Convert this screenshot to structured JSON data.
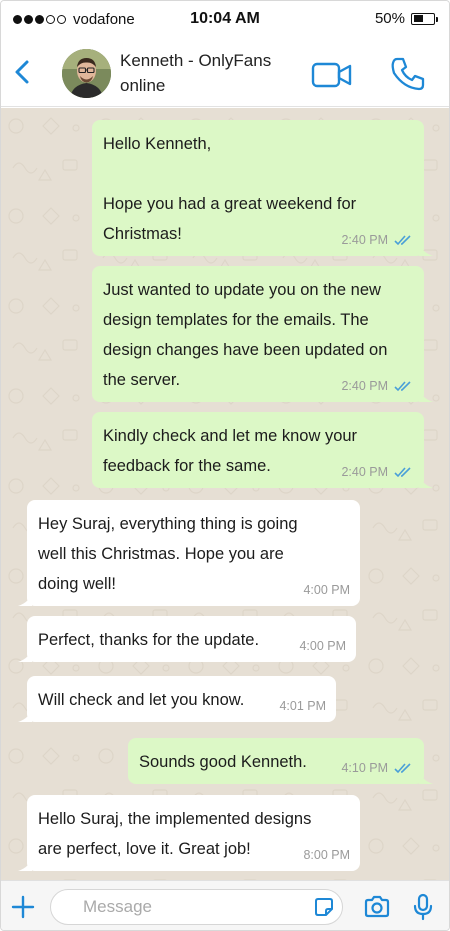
{
  "status_bar": {
    "carrier": "vodafone",
    "signal_bars_filled": 3,
    "signal_bars_total": 5,
    "time": "10:04 AM",
    "battery_text": "50%",
    "battery_level": 0.5
  },
  "header": {
    "contact_name": "Kenneth - OnlyFans",
    "contact_status": "online",
    "icons": {
      "back": "chevron-left-icon",
      "video": "video-camera-icon",
      "call": "phone-icon"
    },
    "accent_color": "#1e88d6"
  },
  "messages": [
    {
      "direction": "out",
      "text": "Hello Kenneth,\n\nHope you had a great weekend for\nChristmas!",
      "time": "2:40 PM",
      "read": true
    },
    {
      "direction": "out",
      "text": "Just wanted to update you on the new\ndesign templates for the emails. The\ndesign changes have been updated on\nthe server.",
      "time": "2:40 PM",
      "read": true
    },
    {
      "direction": "out",
      "text": "Kindly check and let me know your\nfeedback for the same.",
      "time": "2:40 PM",
      "read": true
    },
    {
      "direction": "in",
      "text": "Hey Suraj, everything thing is going\nwell this Christmas. Hope you are\ndoing well!",
      "time": "4:00 PM"
    },
    {
      "direction": "in",
      "text": "Perfect, thanks for the update.",
      "time": "4:00 PM"
    },
    {
      "direction": "in",
      "text": "Will check and let you know.",
      "time": "4:01 PM"
    },
    {
      "direction": "out",
      "text": "Sounds good Kenneth.",
      "time": "4:10 PM",
      "read": true
    },
    {
      "direction": "in",
      "text": "Hello Suraj, the implemented designs\nare perfect, love it. Great job!",
      "time": "8:00 PM"
    }
  ],
  "input_bar": {
    "placeholder": "Message",
    "value": "",
    "icons": {
      "attach": "plus-icon",
      "sticker": "sticker-icon",
      "camera": "camera-icon",
      "mic": "microphone-icon"
    }
  },
  "colors": {
    "outgoing_bubble": "#dcf8c6",
    "incoming_bubble": "#ffffff",
    "chat_background": "#e6dfd4",
    "read_ticks": "#4a9fd8"
  }
}
